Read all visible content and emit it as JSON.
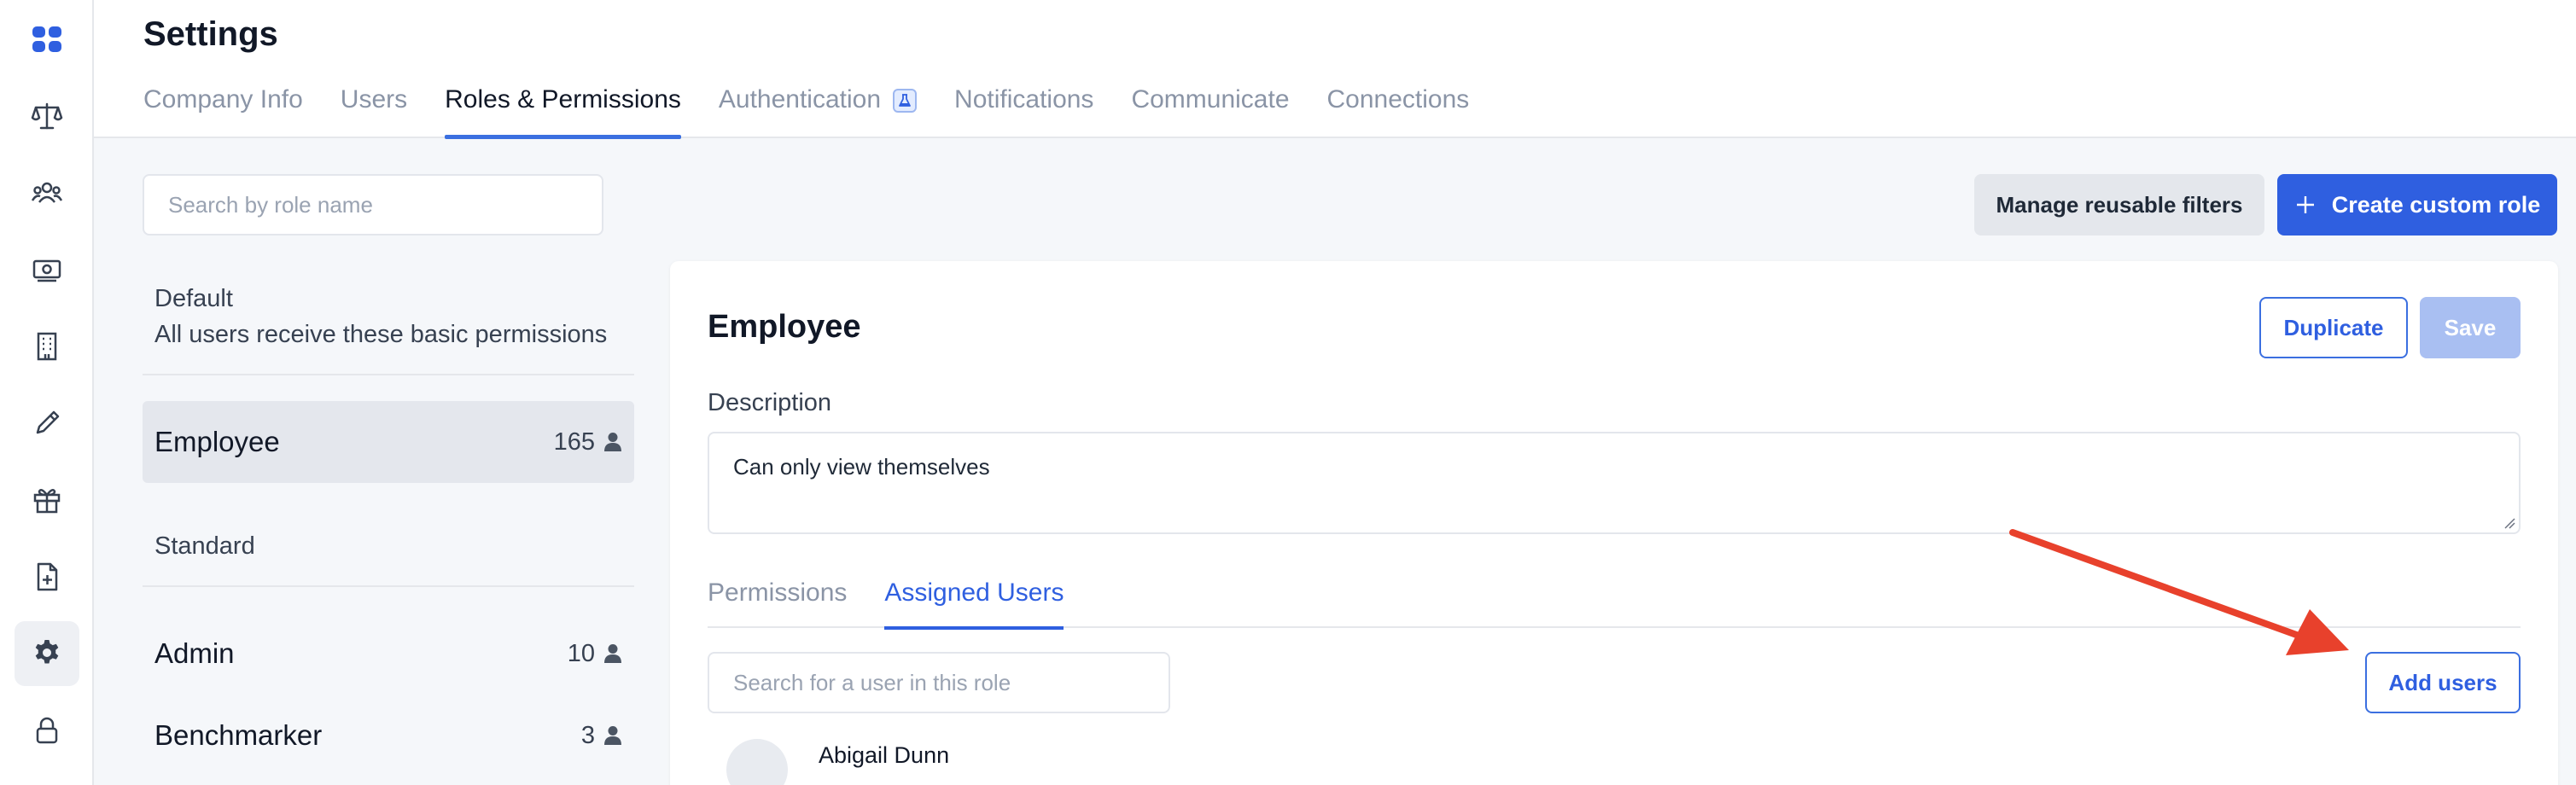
{
  "sidebar": {
    "items": [
      {
        "icon": "apps-grid-icon",
        "active": false
      },
      {
        "icon": "balance-scale-icon",
        "active": false
      },
      {
        "icon": "people-group-icon",
        "active": false
      },
      {
        "icon": "money-icon",
        "active": false
      },
      {
        "icon": "building-icon",
        "active": false
      },
      {
        "icon": "pencil-icon",
        "active": false
      },
      {
        "icon": "gift-icon",
        "active": false
      },
      {
        "icon": "file-add-icon",
        "active": false
      },
      {
        "icon": "gear-icon",
        "active": true
      },
      {
        "icon": "lock-icon",
        "active": false
      }
    ]
  },
  "header": {
    "title": "Settings",
    "tabs": [
      {
        "label": "Company Info",
        "active": false
      },
      {
        "label": "Users",
        "active": false
      },
      {
        "label": "Roles & Permissions",
        "active": true
      },
      {
        "label": "Authentication",
        "active": false,
        "badge": "flask-icon"
      },
      {
        "label": "Notifications",
        "active": false
      },
      {
        "label": "Communicate",
        "active": false
      },
      {
        "label": "Connections",
        "active": false
      }
    ]
  },
  "toolbar": {
    "search_placeholder": "Search by role name",
    "manage_filters_label": "Manage reusable filters",
    "create_role_label": "Create custom role"
  },
  "roles": {
    "default_heading": "Default",
    "default_description": "All users receive these basic permissions",
    "standard_heading": "Standard",
    "items": [
      {
        "name": "Employee",
        "count": "165",
        "active": true
      },
      {
        "name": "Admin",
        "count": "10",
        "active": false
      },
      {
        "name": "Benchmarker",
        "count": "3",
        "active": false
      }
    ]
  },
  "detail": {
    "title": "Employee",
    "duplicate_label": "Duplicate",
    "save_label": "Save",
    "description_label": "Description",
    "description_value": "Can only view themselves",
    "tabs": [
      {
        "label": "Permissions",
        "active": false
      },
      {
        "label": "Assigned Users",
        "active": true
      }
    ],
    "user_search_placeholder": "Search for a user in this role",
    "add_users_label": "Add users",
    "users": [
      {
        "name": "Abigail Dunn"
      }
    ]
  },
  "colors": {
    "accent": "#2f5fe0",
    "annotation_arrow": "#e8412c"
  }
}
